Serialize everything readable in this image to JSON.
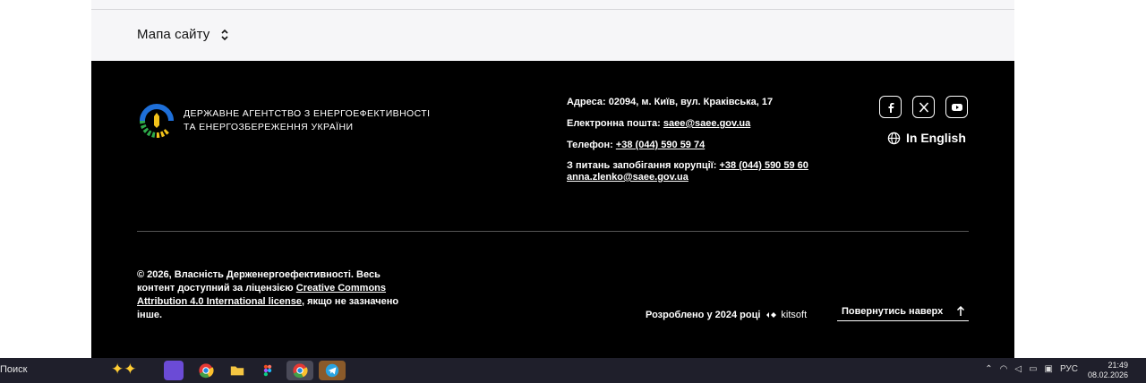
{
  "sitemap": {
    "label": "Мапа сайту",
    "icon": "chevron-up-down-icon"
  },
  "footer": {
    "org_name_line1": "ДЕРЖАВНЕ АГЕНТСТВО З ЕНЕРГОЕФЕКТИВНОСТІ",
    "org_name_line2": "ТА ЕНЕРГОЗБЕРЕЖЕННЯ УКРАЇНИ",
    "address": "Адреса: 02094, м. Київ, вул. Краківська, 17",
    "email_label": "Електронна пошта:",
    "email_value": "saee@saee.gov.ua",
    "phone_label": "Телефон:",
    "phone_value": "+38 (044) 590 59 74",
    "corruption_label": "З питань запобігання корупції:",
    "corruption_phone": "+38 (044) 590 59 60",
    "corruption_email": " anna.zlenko@saee.gov.ua",
    "language_label": "In English",
    "social": [
      "facebook-icon",
      "x-icon",
      "youtube-icon"
    ],
    "copyright_text": "© 2026, Власність Держенергоефективності. Весь контент доступний за ліцензією",
    "license_link": "Creative Commons Attribution 4.0 International license",
    "copyright_tail": ", якщо не зазначено інше.",
    "developed_by": "Розроблено у 2024 році",
    "developer_name": "kitsoft",
    "back_to_top": "Повернутись наверх"
  },
  "taskbar": {
    "search_label": "Поиск",
    "language": "РУС",
    "time": "21:49",
    "date": "08.02.2026"
  },
  "colors": {
    "footer_bg": "#000000",
    "sitemap_bg": "#f6f6f8",
    "taskbar_bg": "#1f1f2b"
  }
}
